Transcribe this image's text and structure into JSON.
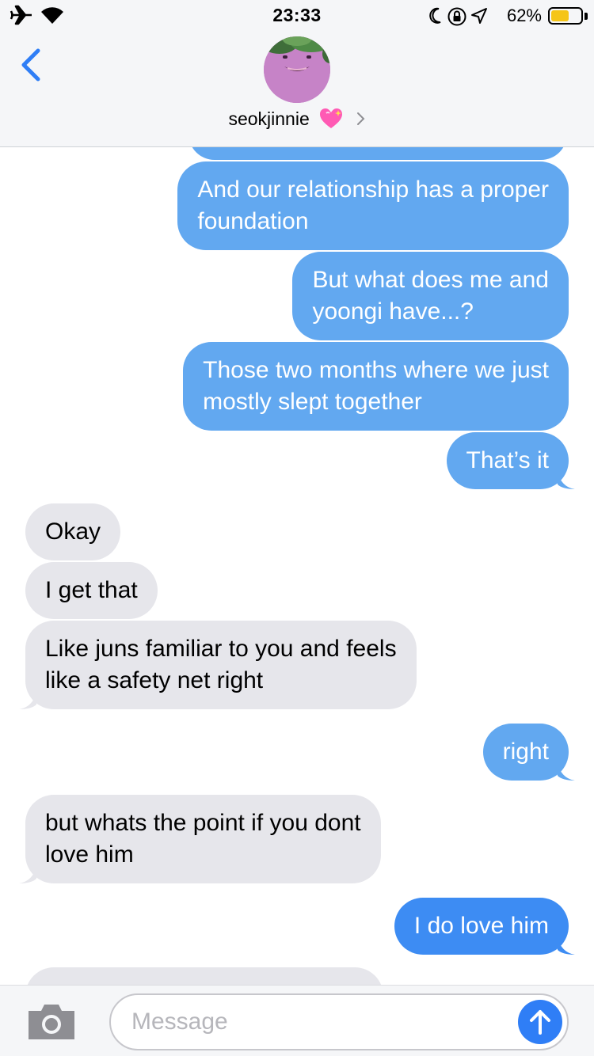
{
  "status_bar": {
    "time": "23:33",
    "battery_percent": "62%",
    "battery_level": 0.62,
    "icons": [
      "airplane-icon",
      "wifi-icon",
      "moon-icon",
      "rotation-lock-icon",
      "location-arrow-icon",
      "battery-icon"
    ]
  },
  "header": {
    "contact_name": "seokjinnie",
    "icons": [
      "back-chevron-icon",
      "sparkling-heart-icon",
      "chevron-right-icon"
    ]
  },
  "messages": [
    {
      "side": "sent",
      "lines": [
        "And our relationship has a proper",
        "foundation"
      ]
    },
    {
      "side": "sent",
      "lines": [
        "But what does me and",
        "yoongi have...?"
      ]
    },
    {
      "side": "sent",
      "lines": [
        "Those two months where we just",
        "mostly slept together"
      ]
    },
    {
      "side": "sent",
      "lines": [
        "That’s it"
      ]
    },
    {
      "side": "received",
      "lines": [
        "Okay"
      ]
    },
    {
      "side": "received",
      "lines": [
        "I get that"
      ]
    },
    {
      "side": "received",
      "lines": [
        "Like juns familiar to you and feels",
        "like a safety net right"
      ]
    },
    {
      "side": "sent",
      "lines": [
        "right"
      ]
    },
    {
      "side": "received",
      "lines": [
        "but whats the point if you dont",
        "love him"
      ]
    },
    {
      "side": "sent",
      "lines": [
        "I do love him"
      ]
    }
  ],
  "input_bar": {
    "placeholder": "Message",
    "icons": [
      "camera-icon",
      "send-arrow-icon"
    ]
  },
  "colors": {
    "sent_bubble": "#62a8f0",
    "received_bubble": "#e6e6eb",
    "accent": "#2f7ef6",
    "battery": "#f5c518"
  }
}
